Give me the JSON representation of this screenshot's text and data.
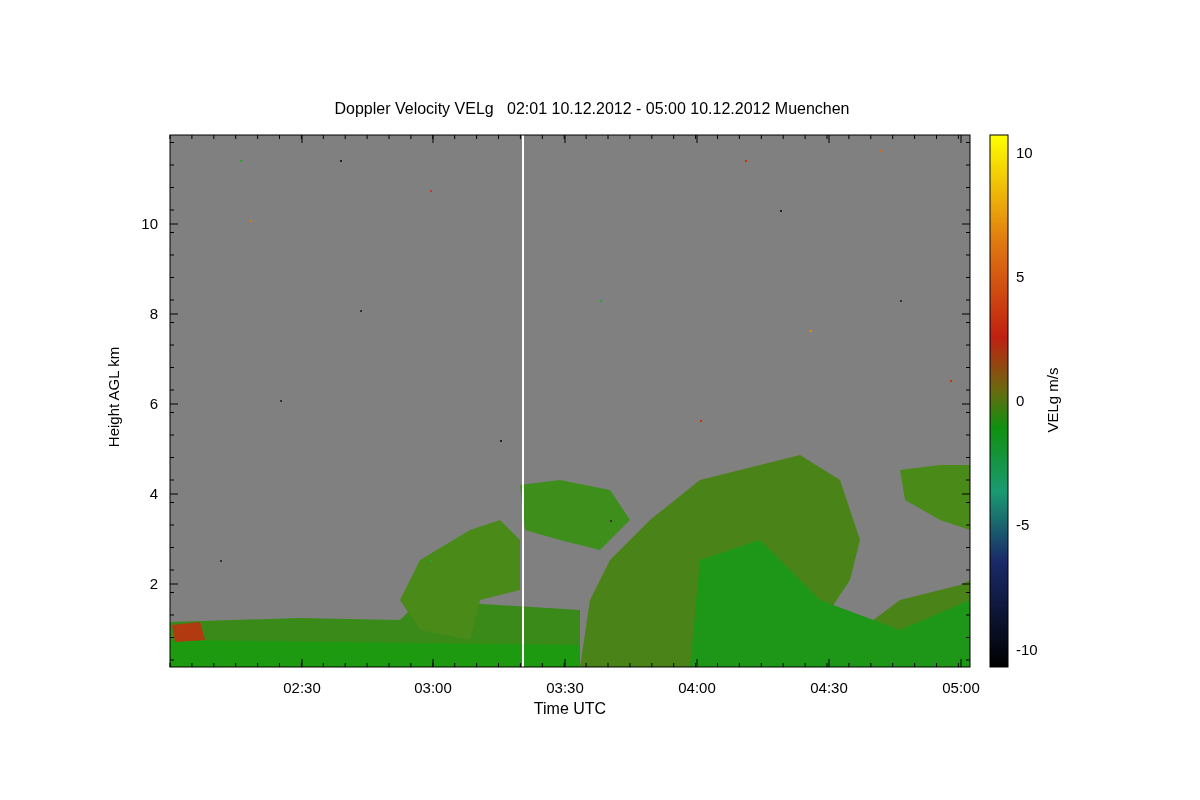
{
  "plot": {
    "title": "Doppler Velocity VELg   02:01 10.12.2012 - 05:00 10.12.2012 Muenchen",
    "xlabel": "Time UTC",
    "ylabel": "Height AGL km",
    "xtick_labels": [
      "02:30",
      "03:00",
      "03:30",
      "04:00",
      "04:30",
      "05:00"
    ],
    "ytick_labels": [
      "10",
      "8",
      "6",
      "4",
      "2"
    ]
  },
  "colorbar": {
    "label": "VELg m/s",
    "tick_labels": [
      "10",
      "5",
      "0",
      "-5",
      "-10"
    ]
  }
}
